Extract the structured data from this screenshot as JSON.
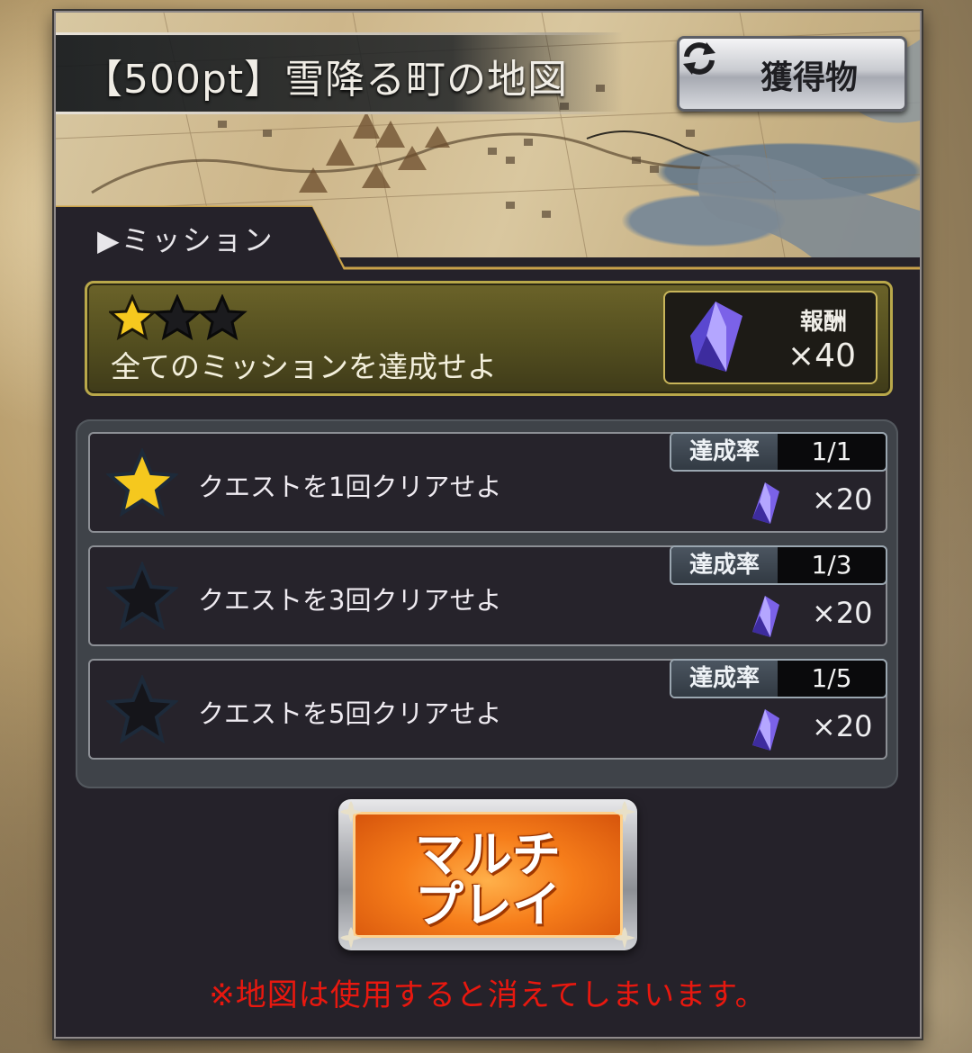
{
  "header": {
    "title": "【500pt】雪降る町の地図",
    "loot_button_label": "獲得物",
    "loot_icon": "refresh-icon"
  },
  "tab": {
    "label": "ミッション",
    "icon": "triangle-right-icon"
  },
  "all_complete": {
    "stars_filled": 1,
    "stars_total": 3,
    "text": "全てのミッションを達成せよ",
    "reward_label": "報酬",
    "reward_value": "×40",
    "reward_icon": "crystal-icon"
  },
  "missions": [
    {
      "text": "クエストを1回クリアせよ",
      "rate_label": "達成率",
      "rate_value": "1/1",
      "reward": "×20",
      "achieved": true
    },
    {
      "text": "クエストを3回クリアせよ",
      "rate_label": "達成率",
      "rate_value": "1/3",
      "reward": "×20",
      "achieved": false
    },
    {
      "text": "クエストを5回クリアせよ",
      "rate_label": "達成率",
      "rate_value": "1/5",
      "reward": "×20",
      "achieved": false
    }
  ],
  "multi_play_button": {
    "label": "マルチ\nプレイ"
  },
  "warning": "※地図は使用すると消えてしまいます。",
  "colors": {
    "panel_bg": "#25222a",
    "gold_box": "#555020",
    "star_gold": "#f5c81e",
    "button_orange": "#f67d1a",
    "warning_red": "#e8180f"
  }
}
